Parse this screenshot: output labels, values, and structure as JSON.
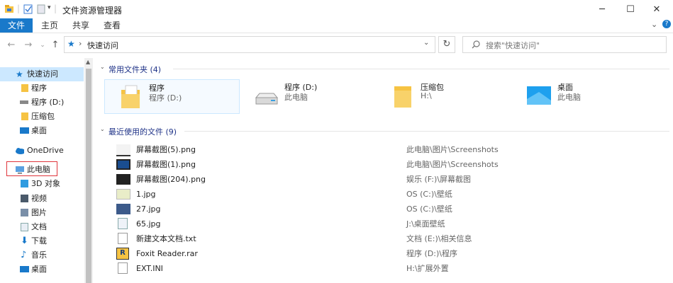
{
  "window": {
    "title": "文件资源管理器"
  },
  "ribbon": {
    "tabs": [
      "文件",
      "主页",
      "共享",
      "查看"
    ]
  },
  "address": {
    "path": "快速访问",
    "search_placeholder": "搜索\"快速访问\""
  },
  "sidebar": {
    "items": [
      {
        "label": "快速访问",
        "icon": "star-icon"
      },
      {
        "label": "程序",
        "icon": "folder-icon"
      },
      {
        "label": "程序 (D:)",
        "icon": "drive-icon"
      },
      {
        "label": "压缩包",
        "icon": "folder-icon"
      },
      {
        "label": "桌面",
        "icon": "desktop-icon"
      },
      {
        "label": "OneDrive",
        "icon": "cloud-icon"
      },
      {
        "label": "此电脑",
        "icon": "pc-icon"
      },
      {
        "label": "3D 对象",
        "icon": "cube-icon"
      },
      {
        "label": "视频",
        "icon": "video-icon"
      },
      {
        "label": "图片",
        "icon": "picture-icon"
      },
      {
        "label": "文档",
        "icon": "document-icon"
      },
      {
        "label": "下载",
        "icon": "download-icon"
      },
      {
        "label": "音乐",
        "icon": "music-icon"
      },
      {
        "label": "桌面",
        "icon": "desktop-icon"
      }
    ]
  },
  "frequent": {
    "header": "常用文件夹 (4)",
    "folders": [
      {
        "name": "程序",
        "sub": "程序 (D:)",
        "icon": "folder-doc-icon"
      },
      {
        "name": "程序 (D:)",
        "sub": "此电脑",
        "icon": "drive-icon"
      },
      {
        "name": "压缩包",
        "sub": "H:\\",
        "icon": "folder-icon"
      },
      {
        "name": "桌面",
        "sub": "此电脑",
        "icon": "desktop-icon"
      }
    ]
  },
  "recent": {
    "header": "最近使用的文件 (9)",
    "files": [
      {
        "name": "屏幕截图(5).png",
        "path": "此电脑\\图片\\Screenshots"
      },
      {
        "name": "屏幕截图(1).png",
        "path": "此电脑\\图片\\Screenshots"
      },
      {
        "name": "屏幕截图(204).png",
        "path": "娱乐 (F:)\\屏幕截图"
      },
      {
        "name": "1.jpg",
        "path": "OS (C:)\\壁纸"
      },
      {
        "name": "27.jpg",
        "path": "OS (C:)\\壁纸"
      },
      {
        "name": "65.jpg",
        "path": "J:\\桌面壁纸"
      },
      {
        "name": "新建文本文档.txt",
        "path": "文档 (E:)\\相关信息"
      },
      {
        "name": "Foxit Reader.rar",
        "path": "程序 (D:)\\程序"
      },
      {
        "name": "EXT.INI",
        "path": "H:\\扩展外置"
      }
    ]
  },
  "colors": {
    "accent": "#1979ca",
    "folder": "#f6c343",
    "selected_border": "#cce8ff",
    "highlight": "#e0353b"
  }
}
